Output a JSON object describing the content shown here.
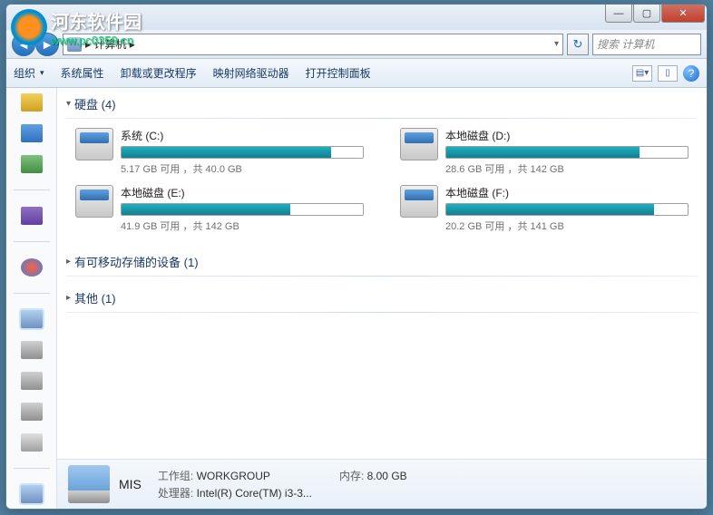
{
  "watermark": {
    "cn": "河东软件园",
    "url": "www.pc0359.cn"
  },
  "window": {
    "breadcrumb": "▸ 计算机 ▸",
    "search_placeholder": "搜索 计算机",
    "min": "—",
    "max": "▢",
    "close": "✕"
  },
  "toolbar": {
    "organize": "组织",
    "sysprops": "系统属性",
    "uninstall": "卸载或更改程序",
    "mapdrive": "映射网络驱动器",
    "ctrlpanel": "打开控制面板"
  },
  "sections": {
    "drives_title": "硬盘 (4)",
    "removable_title": "有可移动存储的设备 (1)",
    "other_title": "其他 (1)"
  },
  "drives": [
    {
      "label": "系统 (C:)",
      "free": "5.17 GB 可用 ，共 40.0 GB",
      "fill": 87
    },
    {
      "label": "本地磁盘 (D:)",
      "free": "28.6 GB 可用 ，共 142 GB",
      "fill": 80
    },
    {
      "label": "本地磁盘 (E:)",
      "free": "41.9 GB 可用 ，共 142 GB",
      "fill": 70
    },
    {
      "label": "本地磁盘 (F:)",
      "free": "20.2 GB 可用 ，共 141 GB",
      "fill": 86
    }
  ],
  "details": {
    "name": "MIS",
    "workgroup_k": "工作组:",
    "workgroup_v": "WORKGROUP",
    "cpu_k": "处理器:",
    "cpu_v": "Intel(R) Core(TM) i3-3...",
    "mem_k": "内存:",
    "mem_v": "8.00 GB"
  }
}
